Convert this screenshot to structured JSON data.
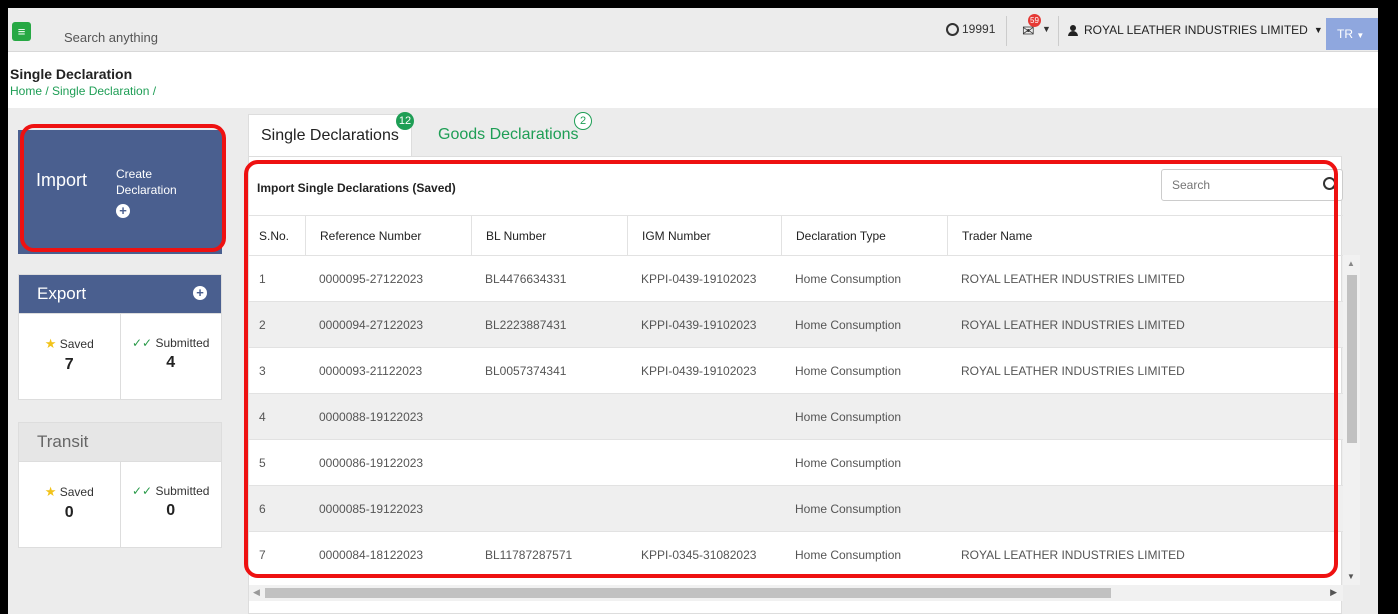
{
  "topbar": {
    "search_placeholder": "Search anything",
    "credits": "19991",
    "mail_count": "59",
    "user_name": "ROYAL LEATHER INDUSTRIES LIMITED",
    "lang": "TR"
  },
  "header": {
    "title": "Single Declaration",
    "breadcrumb": "Home / Single Declaration /"
  },
  "import_card": {
    "title": "Import",
    "create_label": "Create Declaration"
  },
  "export_card": {
    "title": "Export",
    "saved_label": "Saved",
    "saved_count": "7",
    "submitted_label": "Submitted",
    "submitted_count": "4"
  },
  "transit_card": {
    "title": "Transit",
    "saved_label": "Saved",
    "saved_count": "0",
    "submitted_label": "Submitted",
    "submitted_count": "0"
  },
  "tabs": [
    {
      "label": "Single Declarations",
      "badge": "12"
    },
    {
      "label": "Goods Declarations",
      "badge": "2"
    }
  ],
  "table": {
    "title": "Import Single Declarations (Saved)",
    "search_placeholder": "Search",
    "columns": [
      "S.No.",
      "Reference Number",
      "BL Number",
      "IGM Number",
      "Declaration Type",
      "Trader Name"
    ],
    "rows": [
      [
        "1",
        "0000095-27122023",
        "BL4476634331",
        "KPPI-0439-19102023",
        "Home Consumption",
        "ROYAL LEATHER INDUSTRIES LIMITED"
      ],
      [
        "2",
        "0000094-27122023",
        "BL2223887431",
        "KPPI-0439-19102023",
        "Home Consumption",
        "ROYAL LEATHER INDUSTRIES LIMITED"
      ],
      [
        "3",
        "0000093-21122023",
        "BL0057374341",
        "KPPI-0439-19102023",
        "Home Consumption",
        "ROYAL LEATHER INDUSTRIES LIMITED"
      ],
      [
        "4",
        "0000088-19122023",
        "",
        "",
        "Home Consumption",
        ""
      ],
      [
        "5",
        "0000086-19122023",
        "",
        "",
        "Home Consumption",
        ""
      ],
      [
        "6",
        "0000085-19122023",
        "",
        "",
        "Home Consumption",
        ""
      ],
      [
        "7",
        "0000084-18122023",
        "BL11787287571",
        "KPPI-0345-31082023",
        "Home Consumption",
        "ROYAL LEATHER INDUSTRIES LIMITED"
      ]
    ]
  },
  "colors": {
    "accent_green": "#1e9e55",
    "card_blue": "#4a5f8f",
    "annotation_red": "#e11111"
  }
}
